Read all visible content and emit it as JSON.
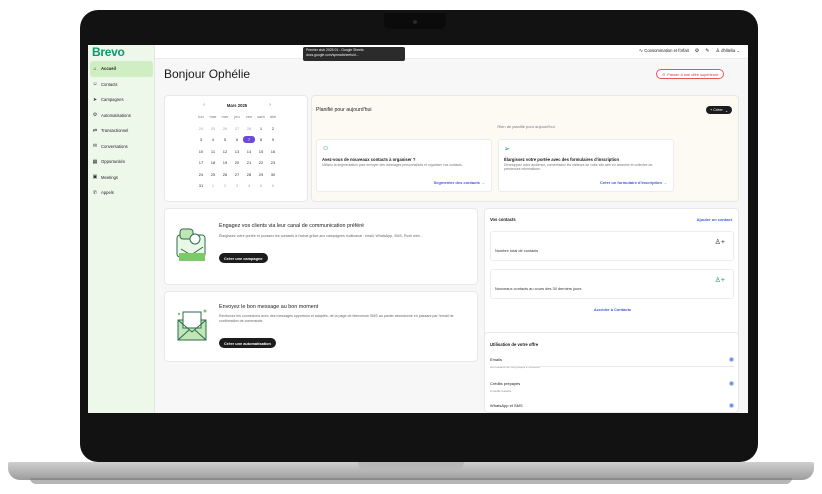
{
  "app": {
    "logo": "Brevo"
  },
  "sidebar": {
    "items": [
      {
        "label": "Accueil",
        "icon": "home-icon",
        "glyph": "⌂",
        "active": true
      },
      {
        "label": "Contacts",
        "icon": "contacts-icon",
        "glyph": "☺"
      },
      {
        "label": "Campagnes",
        "icon": "send-icon",
        "glyph": "➤"
      },
      {
        "label": "Automatisations",
        "icon": "automation-icon",
        "glyph": "⚙"
      },
      {
        "label": "Transactionnel",
        "icon": "transfer-icon",
        "glyph": "⇄"
      },
      {
        "label": "Conversations",
        "icon": "chat-icon",
        "glyph": "✉"
      },
      {
        "label": "Opportunités",
        "icon": "deals-icon",
        "glyph": "▦"
      },
      {
        "label": "Meetings",
        "icon": "calendar-icon",
        "glyph": "▣"
      },
      {
        "label": "Appels",
        "icon": "phone-icon",
        "glyph": "✆"
      }
    ]
  },
  "topbar": {
    "tooltip_line1": "Premier club 2025 01 - Google Sheets",
    "tooltip_line2": "docs.google.com/spreadsheets/d...",
    "plan_label": "Consommation et forfait",
    "user_label": "dhlitelia"
  },
  "greeting": "Bonjour Ophélie",
  "upgrade_label": "Passer à une offre supérieure",
  "calendar": {
    "month": "Mars 2025",
    "weekdays": [
      "lun",
      "mar",
      "mer",
      "jeu",
      "ven",
      "sam",
      "dim"
    ],
    "weeks": [
      [
        "24",
        "25",
        "26",
        "27",
        "28",
        "1",
        "2"
      ],
      [
        "3",
        "4",
        "5",
        "6",
        "7",
        "8",
        "9"
      ],
      [
        "10",
        "11",
        "12",
        "13",
        "14",
        "15",
        "16"
      ],
      [
        "17",
        "18",
        "19",
        "20",
        "21",
        "22",
        "23"
      ],
      [
        "24",
        "25",
        "26",
        "27",
        "28",
        "29",
        "30"
      ],
      [
        "31",
        "1",
        "2",
        "3",
        "4",
        "5",
        "6"
      ]
    ],
    "selected": "7"
  },
  "planned": {
    "title": "Planifié pour aujourd'hui",
    "create_label": "+ Créer",
    "empty": "Rien de planifié pour aujourd'hui",
    "cards": [
      {
        "title": "Avez-vous de nouveaux contacts à organiser ?",
        "desc": "Utilisez la segmentation pour envoyer des messages personnalisés et organiser vos contacts.",
        "link": "Segmenter des contacts →"
      },
      {
        "title": "Élargissez votre portée avec des formulaires d'inscription",
        "desc": "Développez votre audience, convertissez les visiteurs de votre site web en abonnés et collectez de précieuses informations.",
        "link": "Créer un formulaire d'inscription →"
      }
    ]
  },
  "engage": {
    "title": "Engagez vos clients via leur canal de communication préféré",
    "desc": "Élargissez votre portée et poussez les contacts à l'achat grâce aux campagnes multicanal : email, WhatsApp, SMS, Push web...",
    "button": "Créer une campagne"
  },
  "message": {
    "title": "Envoyez le bon message au bon moment",
    "desc": "Renforcez les connexions avec des messages opportuns et adaptés, de la page de bienvenue SMS au panier abandonné en passant par l'email de confirmation de commande.",
    "button": "Créer une automatisation"
  },
  "contacts": {
    "title": "Vos contacts",
    "add_link": "Ajouter un contact",
    "total_label": "Nombre total de contacts",
    "new_label": "Nouveaux contacts au cours des 30 derniers jours",
    "access_link": "Accéder à Contacts"
  },
  "offer": {
    "title": "Utilisation de votre offre",
    "rows": [
      {
        "label": "Emails",
        "sub": "300 restants sur 300 jusqu'à 27/03/2025"
      },
      {
        "label": "Crédits prépayés",
        "sub": "0 crédits restants"
      },
      {
        "label": "WhatsApp et SMS",
        "sub": ""
      }
    ]
  },
  "colors": {
    "brand": "#0b996e",
    "accent": "#6d4bd8",
    "link": "#3d5bd6"
  }
}
